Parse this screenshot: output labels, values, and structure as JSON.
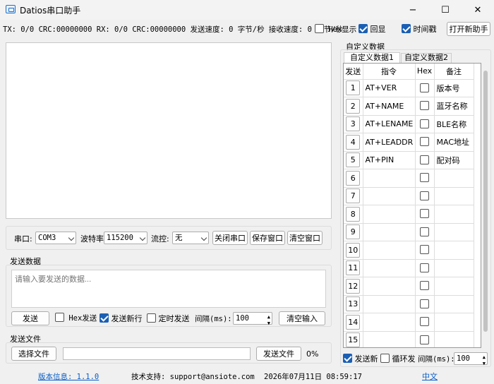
{
  "window": {
    "title": "Datios串口助手",
    "min_glyph": "−",
    "max_glyph": "☐",
    "close_glyph": "✕"
  },
  "status": {
    "text": "TX: 0/0 CRC:00000000 RX: 0/0 CRC:00000000 发送速度: 0 字节/秒 接收速度: 0 字节/秒",
    "hex_display_label": "Hex显示",
    "echo_label": "回显",
    "timestamp_label": "时间戳",
    "open_new_label": "打开新助手"
  },
  "serial": {
    "port_label": "串口:",
    "port_value": "COM3",
    "baud_label": "波特率",
    "baud_value": "115200",
    "flow_label": "流控:",
    "flow_value": "无",
    "close_port": "关闭串口",
    "save_window": "保存窗口",
    "clear_window": "清空窗口"
  },
  "send_data": {
    "group_label": "发送数据",
    "placeholder": "请输入要发送的数据...",
    "send_button": "发送",
    "hex_send_label": "Hex发送",
    "send_newline_label": "发送新行",
    "timed_send_label": "定时发送",
    "interval_label": "间隔(ms):",
    "interval_value": "100",
    "clear_input": "清空输入"
  },
  "send_file": {
    "group_label": "发送文件",
    "choose_file": "选择文件",
    "send_file_button": "发送文件",
    "progress": "0%"
  },
  "custom": {
    "group_label": "自定义数据",
    "tabs": [
      "自定义数据1",
      "自定义数据2"
    ],
    "headers": {
      "send": "发送",
      "command": "指令",
      "hex": "Hex",
      "note": "备注"
    },
    "rows": [
      {
        "n": "1",
        "cmd": "AT+VER",
        "note": "版本号"
      },
      {
        "n": "2",
        "cmd": "AT+NAME",
        "note": "蓝牙名称"
      },
      {
        "n": "3",
        "cmd": "AT+LENAME",
        "note": "BLE名称"
      },
      {
        "n": "4",
        "cmd": "AT+LEADDR",
        "note": "MAC地址"
      },
      {
        "n": "5",
        "cmd": "AT+PIN",
        "note": "配对码"
      },
      {
        "n": "6",
        "cmd": "",
        "note": ""
      },
      {
        "n": "7",
        "cmd": "",
        "note": ""
      },
      {
        "n": "8",
        "cmd": "",
        "note": ""
      },
      {
        "n": "9",
        "cmd": "",
        "note": ""
      },
      {
        "n": "10",
        "cmd": "",
        "note": ""
      },
      {
        "n": "11",
        "cmd": "",
        "note": ""
      },
      {
        "n": "12",
        "cmd": "",
        "note": ""
      },
      {
        "n": "13",
        "cmd": "",
        "note": ""
      },
      {
        "n": "14",
        "cmd": "",
        "note": ""
      },
      {
        "n": "15",
        "cmd": "",
        "note": ""
      }
    ],
    "send_newline_label": "发送新",
    "loop_send_label": "循环发",
    "interval_label": "间隔(ms):",
    "interval_value": "100"
  },
  "footer": {
    "version": "版本信息: 1.1.0",
    "support": "技术支持: support@ansiote.com",
    "datetime": "2026年07月11日 08:59:17",
    "language": "中文"
  },
  "colors": {
    "accent": "#1a5fb4",
    "link": "#0a5ec8"
  }
}
